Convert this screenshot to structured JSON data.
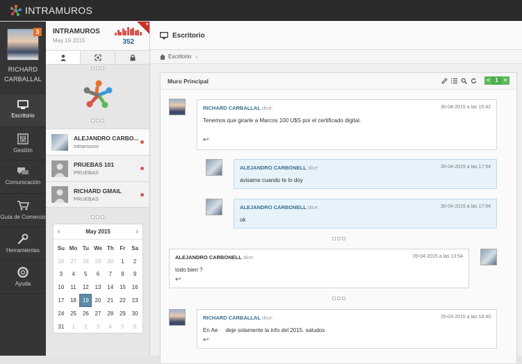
{
  "app": {
    "name": "INTRAMUROS"
  },
  "user": {
    "first_name": "RICHARD",
    "last_name": "CARBALLAL",
    "badge": "3"
  },
  "nav": [
    {
      "id": "escritorio",
      "label": "Escritorio",
      "icon": "monitor-icon",
      "active": true
    },
    {
      "id": "gestion",
      "label": "Gestión",
      "icon": "sliders-icon"
    },
    {
      "id": "comunicacion",
      "label": "Comunicación",
      "icon": "chat-icon"
    },
    {
      "id": "guia",
      "label": "Guía de Comercio",
      "icon": "cart-icon"
    },
    {
      "id": "herramientas",
      "label": "Herramientas",
      "icon": "wrench-icon"
    },
    {
      "id": "ayuda",
      "label": "Ayuda",
      "icon": "lifebuoy-icon"
    }
  ],
  "panel": {
    "title": "INTRAMUROS",
    "date": "May 19 2015",
    "stat": "352",
    "bars": [
      4,
      7,
      5,
      9,
      6,
      11,
      8,
      10,
      6,
      7,
      5
    ],
    "corner_symbol": "+"
  },
  "contacts": [
    {
      "name": "ALEJANDRO CARBO...",
      "sub": "Intramuros",
      "avatar": "photo"
    },
    {
      "name": "PRUEBAS 101",
      "sub": "PRUEBAS",
      "avatar": "default"
    },
    {
      "name": "RICHARD GMAIL",
      "sub": "PRUEBAS",
      "avatar": "default"
    }
  ],
  "calendar": {
    "month": "May 2015",
    "prev": "‹",
    "next": "›",
    "days_of_week": [
      "Su",
      "Mo",
      "Tu",
      "We",
      "Th",
      "Fr",
      "Sa"
    ],
    "weeks": [
      [
        "26",
        "27",
        "28",
        "29",
        "30",
        "1",
        "2"
      ],
      [
        "3",
        "4",
        "5",
        "6",
        "7",
        "8",
        "9"
      ],
      [
        "10",
        "11",
        "12",
        "13",
        "14",
        "15",
        "16"
      ],
      [
        "17",
        "18",
        "19",
        "20",
        "21",
        "22",
        "23"
      ],
      [
        "24",
        "25",
        "26",
        "27",
        "28",
        "29",
        "30"
      ],
      [
        "31",
        "1",
        "2",
        "3",
        "4",
        "5",
        "6"
      ]
    ],
    "today": "19"
  },
  "main": {
    "title": "Escritorio",
    "breadcrumb": "Escritorio",
    "breadcrumb_sep": "›"
  },
  "wall": {
    "title": "Muro Principal",
    "page": "1",
    "prev": "<",
    "next": ">",
    "dice": "dice:",
    "posts": [
      {
        "author": "RICHARD CARBALLAL",
        "date": "30-04-2015 a las 15:42",
        "text": "Tenemos que girarle a Marcos 100 U$S por el certificado digital."
      },
      {
        "author": "ALEJANDRO CARBONELL",
        "date": "30-04-2015 a las 17:54",
        "text": "avisame cuando te lo doy"
      },
      {
        "author": "ALEJANDRO CARBONELL",
        "date": "30-04-2015 a las 17:54",
        "text": "ok"
      },
      {
        "author": "ALEJANDRO CARBONELL",
        "date": "09-04-2015 a las 13:54",
        "text": "todo bien ?"
      },
      {
        "author": "RICHARD CARBALLAL",
        "date": "25-03-2015 a las 18:40",
        "text": "En Ae     deje solamente la info del 2015. saludos"
      }
    ]
  }
}
